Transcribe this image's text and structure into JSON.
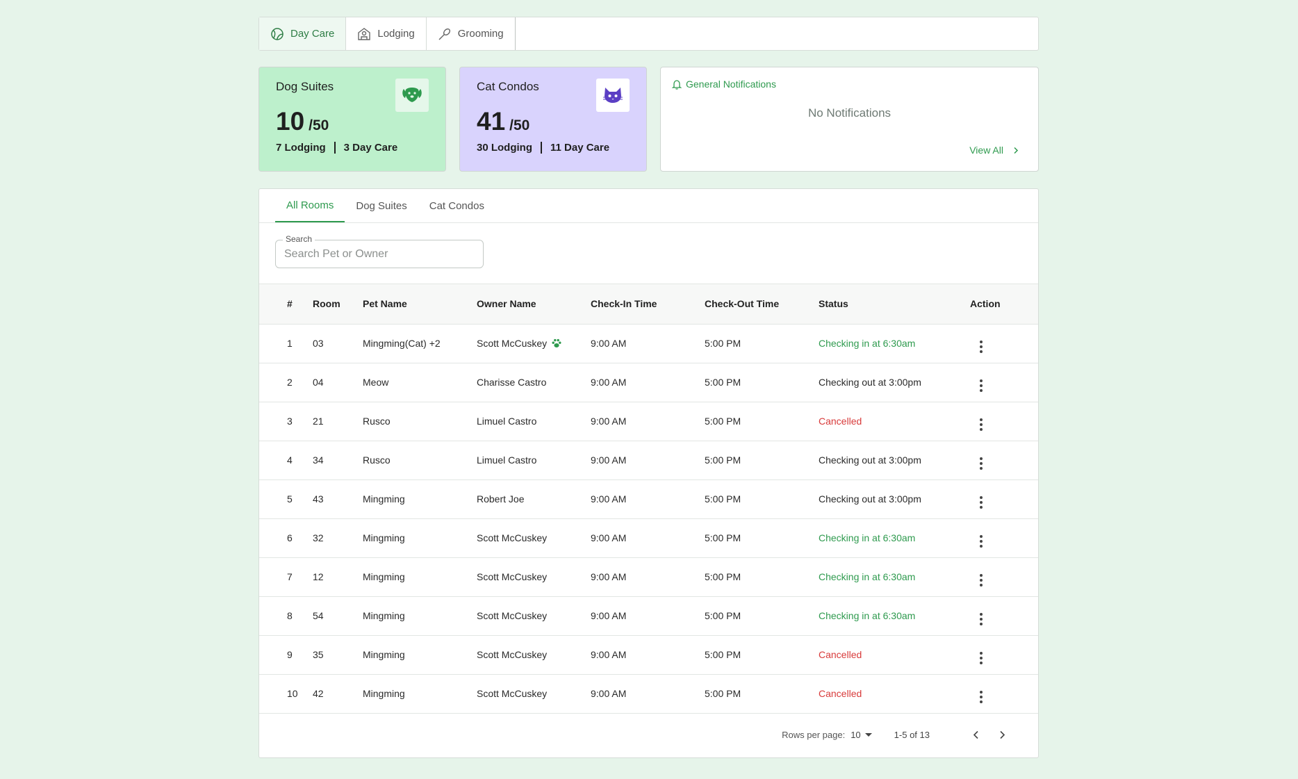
{
  "service_tabs": [
    {
      "label": "Day Care",
      "icon": "tennis-ball-icon"
    },
    {
      "label": "Lodging",
      "icon": "kennel-icon"
    },
    {
      "label": "Grooming",
      "icon": "brush-icon"
    }
  ],
  "cards": {
    "dog": {
      "title": "Dog Suites",
      "count": "10",
      "capacity": "/50",
      "lodging": "7 Lodging",
      "daycare": "3 Day Care",
      "icon": "dog-face-icon"
    },
    "cat": {
      "title": "Cat Condos",
      "count": "41",
      "capacity": "/50",
      "lodging": "30 Lodging",
      "daycare": "11 Day Care",
      "icon": "cat-face-icon"
    },
    "notifications": {
      "title": "General Notifications",
      "empty": "No Notifications",
      "view_all": "View All"
    }
  },
  "room_tabs": [
    "All Rooms",
    "Dog Suites",
    "Cat Condos"
  ],
  "search": {
    "label": "Search",
    "placeholder": "Search Pet or Owner"
  },
  "table": {
    "headers": [
      "#",
      "Room",
      "Pet Name",
      "Owner Name",
      "Check-In Time",
      "Check-Out Time",
      "Status",
      "Action"
    ],
    "rows": [
      {
        "n": "1",
        "room": "03",
        "pet": "Mingming(Cat) +2",
        "owner": "Scott McCuskey",
        "paw": true,
        "in": "9:00 AM",
        "out": "5:00 PM",
        "status": "Checking in at 6:30am",
        "kind": "in"
      },
      {
        "n": "2",
        "room": "04",
        "pet": "Meow",
        "owner": "Charisse Castro",
        "paw": false,
        "in": "9:00 AM",
        "out": "5:00 PM",
        "status": "Checking out at 3:00pm",
        "kind": "out"
      },
      {
        "n": "3",
        "room": "21",
        "pet": "Rusco",
        "owner": "Limuel Castro",
        "paw": false,
        "in": "9:00 AM",
        "out": "5:00 PM",
        "status": "Cancelled",
        "kind": "cancel"
      },
      {
        "n": "4",
        "room": "34",
        "pet": "Rusco",
        "owner": "Limuel Castro",
        "paw": false,
        "in": "9:00 AM",
        "out": "5:00 PM",
        "status": "Checking out at 3:00pm",
        "kind": "out"
      },
      {
        "n": "5",
        "room": "43",
        "pet": "Mingming",
        "owner": "Robert Joe",
        "paw": false,
        "in": "9:00 AM",
        "out": "5:00 PM",
        "status": "Checking out at 3:00pm",
        "kind": "out"
      },
      {
        "n": "6",
        "room": "32",
        "pet": "Mingming",
        "owner": "Scott McCuskey",
        "paw": false,
        "in": "9:00 AM",
        "out": "5:00 PM",
        "status": "Checking in at 6:30am",
        "kind": "in"
      },
      {
        "n": "7",
        "room": "12",
        "pet": "Mingming",
        "owner": "Scott McCuskey",
        "paw": false,
        "in": "9:00 AM",
        "out": "5:00 PM",
        "status": "Checking in at 6:30am",
        "kind": "in"
      },
      {
        "n": "8",
        "room": "54",
        "pet": "Mingming",
        "owner": "Scott McCuskey",
        "paw": false,
        "in": "9:00 AM",
        "out": "5:00 PM",
        "status": "Checking in at 6:30am",
        "kind": "in"
      },
      {
        "n": "9",
        "room": "35",
        "pet": "Mingming",
        "owner": "Scott McCuskey",
        "paw": false,
        "in": "9:00 AM",
        "out": "5:00 PM",
        "status": "Cancelled",
        "kind": "cancel"
      },
      {
        "n": "10",
        "room": "42",
        "pet": "Mingming",
        "owner": "Scott McCuskey",
        "paw": false,
        "in": "9:00 AM",
        "out": "5:00 PM",
        "status": "Cancelled",
        "kind": "cancel"
      }
    ]
  },
  "pagination": {
    "rows_label": "Rows per page:",
    "rows_value": "10",
    "range": "1-5 of 13"
  },
  "colors": {
    "accent_green": "#2e9a4e",
    "cancel_red": "#d83a3a",
    "dog_card": "#bdf0cc",
    "cat_card": "#d9d3fd",
    "cat_icon": "#5b3fc4",
    "background": "#e6f4ea"
  }
}
